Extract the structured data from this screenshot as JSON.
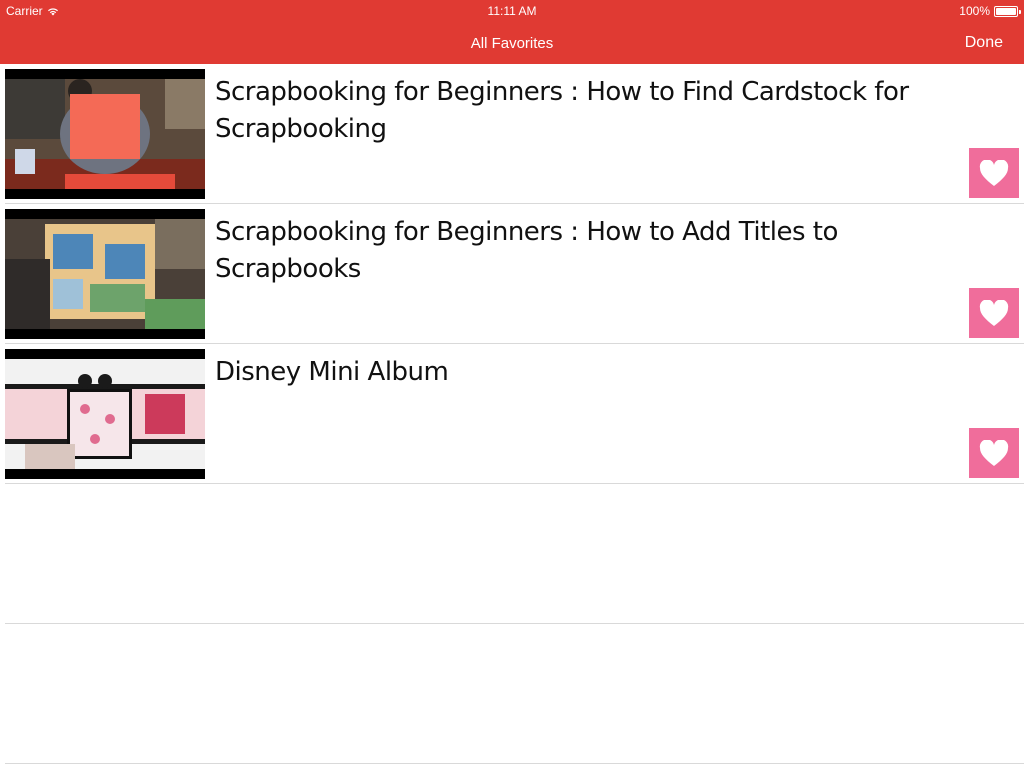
{
  "status_bar": {
    "carrier": "Carrier",
    "time": "11:11 AM",
    "battery": "100%"
  },
  "nav": {
    "title": "All Favorites",
    "done_label": "Done"
  },
  "favorites": [
    {
      "title": "Scrapbooking for Beginners : How to Find Cardstock for Scrapbooking",
      "thumbnail_icon": "video-thumbnail"
    },
    {
      "title": "Scrapbooking for Beginners : How to Add Titles to Scrapbooks",
      "thumbnail_icon": "video-thumbnail"
    },
    {
      "title": "Disney Mini Album",
      "thumbnail_icon": "video-thumbnail"
    }
  ],
  "colors": {
    "accent": "#e03a33",
    "favorite_button": "#f06d9b"
  }
}
